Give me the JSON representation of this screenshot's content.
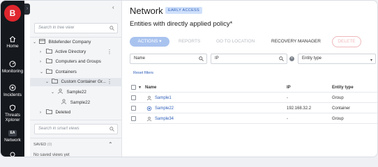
{
  "rail": {
    "logo_letter": "B",
    "items": [
      {
        "label": "Home",
        "icon": "home-icon"
      },
      {
        "label": "Monitoring",
        "icon": "monitoring-icon"
      },
      {
        "label": "Incidents",
        "icon": "incidents-icon"
      },
      {
        "label": "Threats\nXplorer",
        "icon": "shield-icon"
      },
      {
        "label": "Network",
        "icon": "network-badge-icon",
        "badge": "EA"
      }
    ]
  },
  "tree": {
    "search_placeholder": "Search in tree view",
    "nodes": [
      {
        "label": "Bitdefender Company",
        "chev": "⌄"
      },
      {
        "label": "Active Directory",
        "chev": "›"
      },
      {
        "label": "Computers and Groups",
        "chev": "›"
      },
      {
        "label": "Containers",
        "chev": "⌄"
      },
      {
        "label": "Custom Container Gr...",
        "chev": "⌄"
      },
      {
        "label": "Sample22",
        "chev": "⌄"
      },
      {
        "label": "Sample22",
        "chev": ""
      },
      {
        "label": "Deleted",
        "chev": "›"
      }
    ],
    "smart_search_placeholder": "Search in smart views",
    "saved_label": "SAVED",
    "saved_count": "(0)",
    "empty_text": "No saved views yet"
  },
  "main": {
    "title": "Network",
    "badge": "EARLY ACCESS",
    "subtitle": "Entities with directly applied policy*",
    "toolbar": {
      "actions": "ACTIONS",
      "reports": "REPORTS",
      "goto": "GO TO LOCATION",
      "recovery": "RECOVERY MANAGER",
      "delete": "DELETE"
    },
    "filters": {
      "name": "Name",
      "ip": "IP",
      "entity_type": "Entity type"
    },
    "reset": "Reset filters",
    "columns": {
      "name": "Name",
      "ip": "IP",
      "type": "Entity type"
    },
    "rows": [
      {
        "name": "Sample1",
        "ip": "-",
        "type": "Group",
        "icon": "group-icon"
      },
      {
        "name": "Sample22",
        "ip": "192.168.32.2",
        "type": "Container",
        "icon": "container-icon"
      },
      {
        "name": "Sample34",
        "ip": "-",
        "type": "Group",
        "icon": "group-icon"
      }
    ]
  },
  "colors": {
    "accent": "#2d5db8",
    "brand": "#e0262e",
    "rail": "#15181d"
  }
}
